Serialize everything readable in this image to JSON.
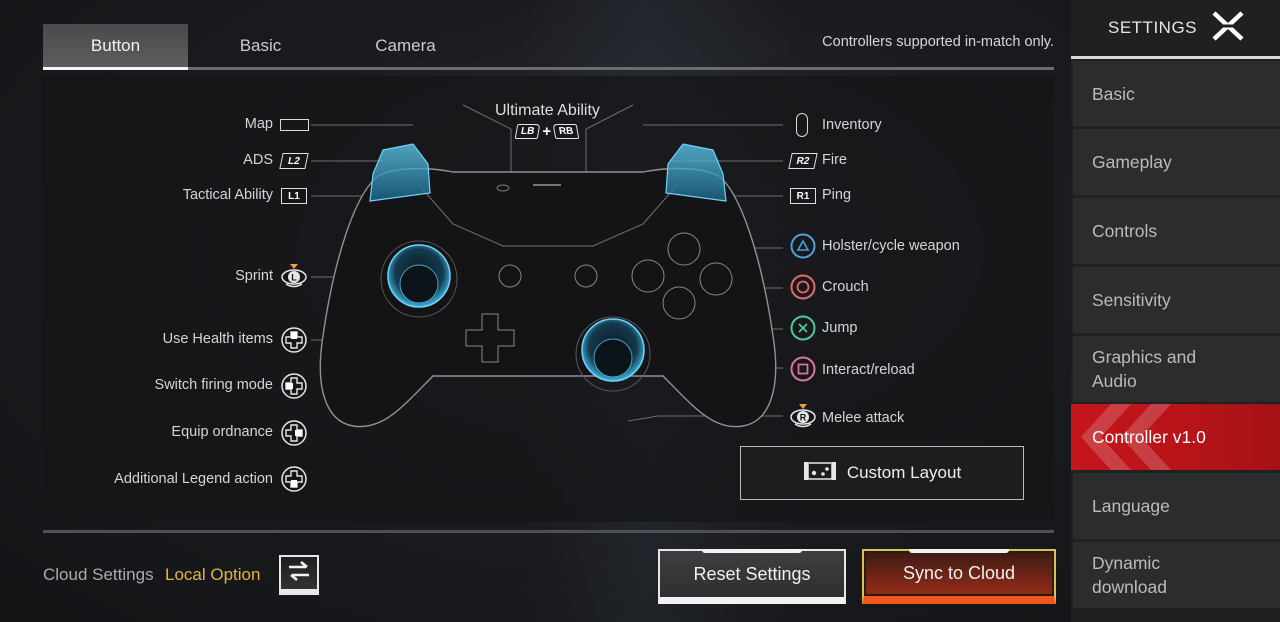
{
  "tabs": [
    {
      "label": "Button",
      "active": true
    },
    {
      "label": "Basic",
      "active": false
    },
    {
      "label": "Camera",
      "active": false
    }
  ],
  "notice": "Controllers supported in-match only.",
  "diagram": {
    "ultimate": {
      "label": "Ultimate Ability",
      "combo": [
        "LB",
        "RB"
      ],
      "plus": "+"
    },
    "left_bindings": [
      {
        "label": "Map",
        "icon": "touchpad-icon"
      },
      {
        "label": "ADS",
        "icon": "l2-trigger-icon",
        "glyph": "L2"
      },
      {
        "label": "Tactical Ability",
        "icon": "l1-bumper-icon",
        "glyph": "L1"
      },
      {
        "label": "Sprint",
        "icon": "left-stick-press-icon",
        "glyph": "L"
      },
      {
        "label": "Use Health items",
        "icon": "dpad-up-icon"
      },
      {
        "label": "Switch firing mode",
        "icon": "dpad-left-icon"
      },
      {
        "label": "Equip ordnance",
        "icon": "dpad-right-icon"
      },
      {
        "label": "Additional Legend action",
        "icon": "dpad-down-icon"
      }
    ],
    "right_bindings": [
      {
        "label": "Inventory",
        "icon": "options-button-icon"
      },
      {
        "label": "Fire",
        "icon": "r2-trigger-icon",
        "glyph": "R2"
      },
      {
        "label": "Ping",
        "icon": "r1-bumper-icon",
        "glyph": "R1"
      },
      {
        "label": "Holster/cycle weapon",
        "icon": "triangle-button-icon",
        "color": "#4aa3d8"
      },
      {
        "label": "Crouch",
        "icon": "circle-button-icon",
        "color": "#e06a6a"
      },
      {
        "label": "Jump",
        "icon": "cross-button-icon",
        "color": "#4fc79a"
      },
      {
        "label": "Interact/reload",
        "icon": "square-button-icon",
        "color": "#d774a8"
      },
      {
        "label": "Melee attack",
        "icon": "right-stick-press-icon",
        "glyph": "R"
      }
    ],
    "custom_layout_label": "Custom Layout"
  },
  "footer": {
    "cloud_label": "Cloud Settings",
    "cloud_value": "Local Option",
    "reset_label": "Reset Settings",
    "sync_label": "Sync to Cloud"
  },
  "sidebar": {
    "title": "SETTINGS",
    "items": [
      {
        "label": "Basic",
        "active": false
      },
      {
        "label": "Gameplay",
        "active": false
      },
      {
        "label": "Controls",
        "active": false
      },
      {
        "label": "Sensitivity",
        "active": false
      },
      {
        "label": "Graphics and Audio",
        "active": false
      },
      {
        "label": "Controller v1.0",
        "active": true
      },
      {
        "label": "Language",
        "active": false
      },
      {
        "label": "Dynamic download",
        "active": false
      }
    ]
  },
  "colors": {
    "accent_red": "#c4161c",
    "accent_gold": "#e6b43a",
    "sync_orange": "#f0561f",
    "controller_blue": "#3fb8e6"
  }
}
